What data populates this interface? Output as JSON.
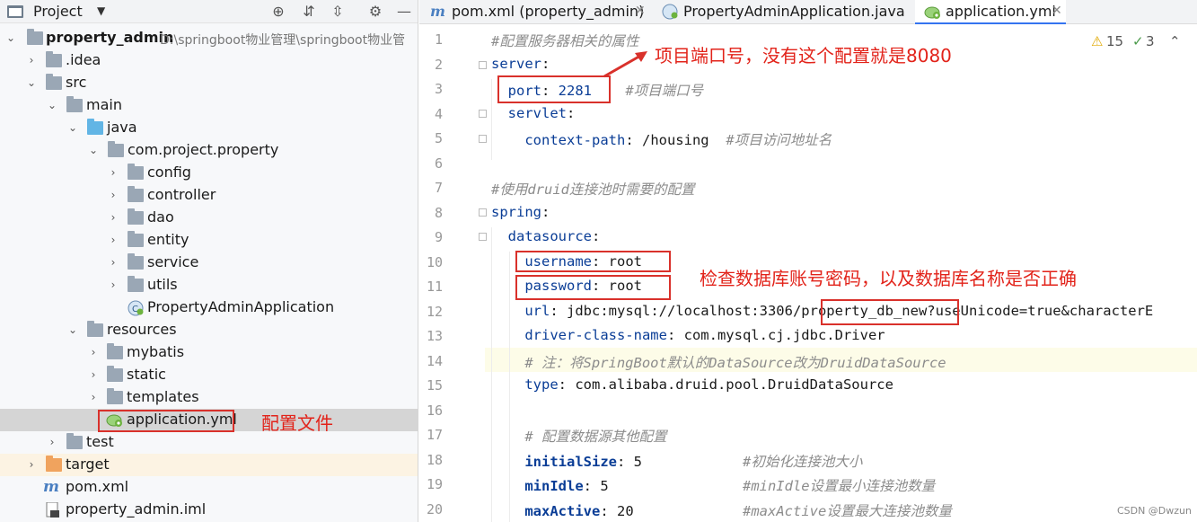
{
  "project_panel": {
    "title": "Project",
    "tree": [
      {
        "label": "property_admin",
        "path": "D:\\springboot物业管理\\springboot物业管",
        "bold": true
      },
      {
        "label": ".idea"
      },
      {
        "label": "src"
      },
      {
        "label": "main"
      },
      {
        "label": "java"
      },
      {
        "label": "com.project.property"
      },
      {
        "label": "config"
      },
      {
        "label": "controller"
      },
      {
        "label": "dao"
      },
      {
        "label": "entity"
      },
      {
        "label": "service"
      },
      {
        "label": "utils"
      },
      {
        "label": "PropertyAdminApplication"
      },
      {
        "label": "resources"
      },
      {
        "label": "mybatis"
      },
      {
        "label": "static"
      },
      {
        "label": "templates"
      },
      {
        "label": "application.yml"
      },
      {
        "label": "test"
      },
      {
        "label": "target"
      },
      {
        "label": "pom.xml"
      },
      {
        "label": "property_admin.iml"
      }
    ]
  },
  "tabs": [
    {
      "label": "pom.xml (property_admin)"
    },
    {
      "label": "PropertyAdminApplication.java"
    },
    {
      "label": "application.yml"
    }
  ],
  "inspections": {
    "warnings": "15",
    "ok": "3"
  },
  "code": {
    "l1": "#配置服务器相关的属性",
    "l2_key": "server",
    "l3_key": "port",
    "l3_val": "2281",
    "l3_comment": "#项目端口号",
    "l4_key": "servlet",
    "l5_key": "context-path",
    "l5_val": "/housing",
    "l5_comment": "#项目访问地址名",
    "l7": "#使用druid连接池时需要的配置",
    "l8_key": "spring",
    "l9_key": "datasource",
    "l10_key": "username",
    "l10_val": "root",
    "l11_key": "password",
    "l11_val": "root",
    "l12_key": "url",
    "l12_val_a": "jdbc:mysql://localhost:3306/",
    "l12_val_b": "property_db_new",
    "l12_val_c": "?useUnicode=true&characterE",
    "l13_key": "driver-class-name",
    "l13_val": "com.mysql.cj.jdbc.Driver",
    "l14": "# 注：将SpringBoot默认的DataSource改为DruidDataSource",
    "l15_key": "type",
    "l15_val": "com.alibaba.druid.pool.DruidDataSource",
    "l17": "# 配置数据源其他配置",
    "l18_key": "initialSize",
    "l18_val": "5",
    "l18_comment": "#初始化连接池大小",
    "l19_key": "minIdle",
    "l19_val": "5",
    "l19_comment": "#minIdle设置最小连接池数量",
    "l20_key": "maxActive",
    "l20_val": "20",
    "l20_comment": "#maxActive设置最大连接池数量"
  },
  "line_numbers": [
    "1",
    "2",
    "3",
    "4",
    "5",
    "6",
    "7",
    "8",
    "9",
    "10",
    "11",
    "12",
    "13",
    "14",
    "15",
    "16",
    "17",
    "18",
    "19",
    "20"
  ],
  "annotations": {
    "port_note": "项目端口号，没有这个配置就是8080",
    "db_note": "检查数据库账号密码，以及数据库名称是否正确",
    "config_note": "配置文件"
  },
  "watermark": "CSDN @Dwzun",
  "colors": {
    "annotation": "#e2231a",
    "key": "#0a3d96",
    "comment": "#8c8c8c"
  }
}
